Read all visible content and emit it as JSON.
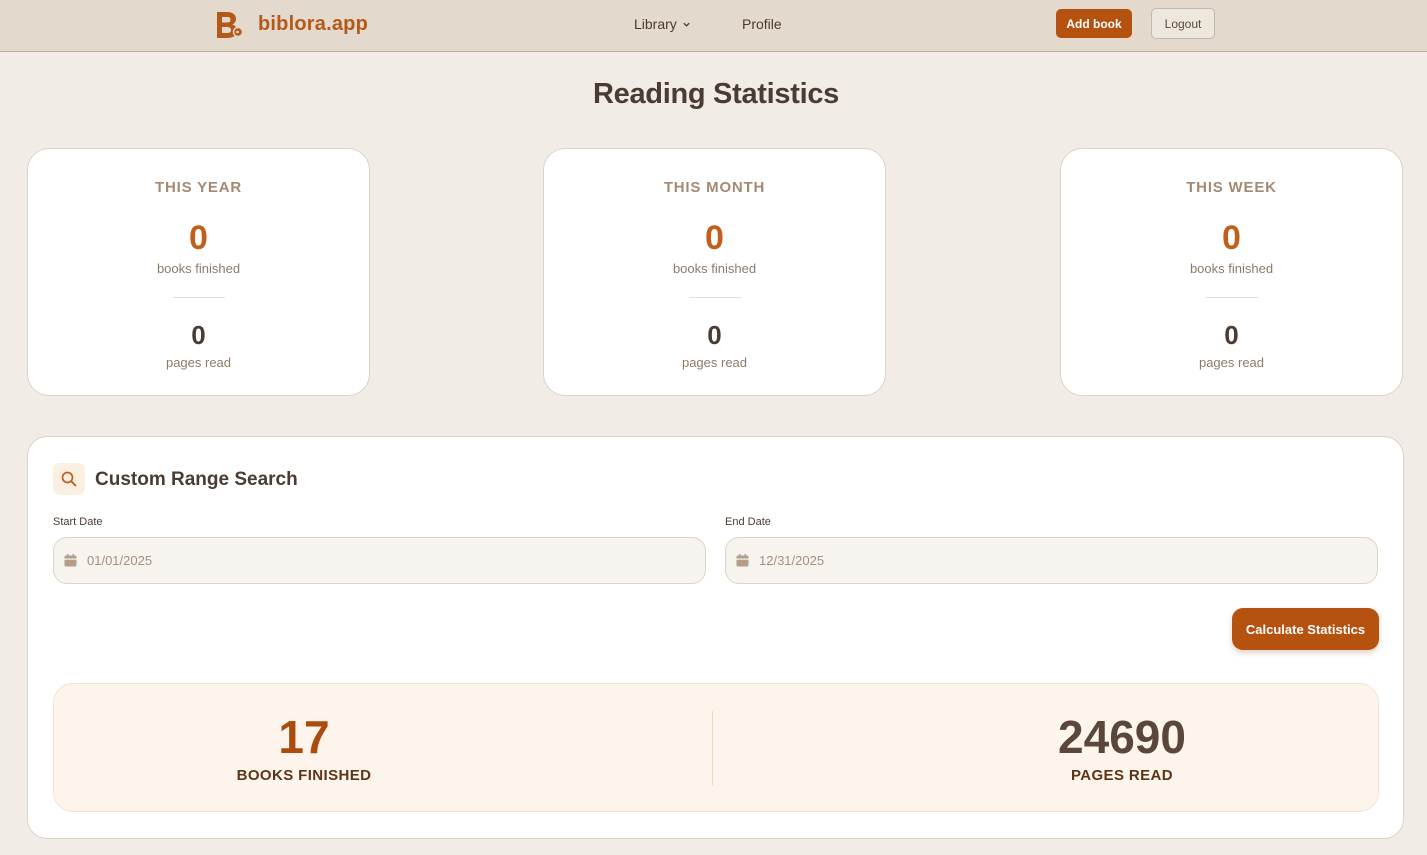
{
  "header": {
    "brand": "biblora.app",
    "nav": {
      "library": "Library",
      "profile": "Profile"
    },
    "add_book": "Add book",
    "logout": "Logout"
  },
  "page_title": "Reading Statistics",
  "cards": [
    {
      "label": "THIS YEAR",
      "books": "0",
      "books_caption": "books finished",
      "pages": "0",
      "pages_caption": "pages read"
    },
    {
      "label": "THIS MONTH",
      "books": "0",
      "books_caption": "books finished",
      "pages": "0",
      "pages_caption": "pages read"
    },
    {
      "label": "THIS WEEK",
      "books": "0",
      "books_caption": "books finished",
      "pages": "0",
      "pages_caption": "pages read"
    }
  ],
  "custom_range": {
    "title": "Custom Range Search",
    "start_label": "Start Date",
    "start_value": "01/01/2025",
    "end_label": "End Date",
    "end_value": "12/31/2025",
    "button": "Calculate Statistics",
    "results": {
      "books_value": "17",
      "books_caption": "BOOKS FINISHED",
      "pages_value": "24690",
      "pages_caption": "PAGES READ"
    }
  },
  "colors": {
    "accent": "#b5520f",
    "brand": "#b5591a",
    "header_bg": "#e3d9cd",
    "page_bg": "#f1ece6"
  },
  "icons": [
    "brand-logo-icon",
    "chevron-down-icon",
    "search-icon",
    "calendar-icon"
  ]
}
